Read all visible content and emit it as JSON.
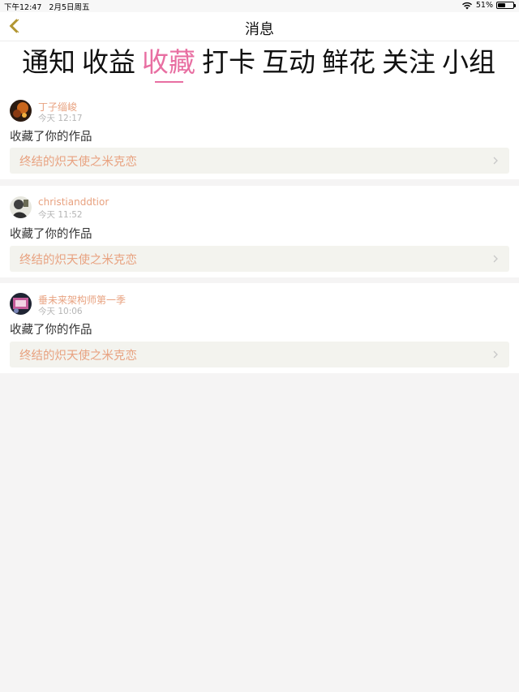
{
  "status": {
    "time": "下午12:47",
    "date": "2月5日周五",
    "battery": "51%",
    "battery_level": 0.51
  },
  "nav": {
    "title": "消息",
    "back_icon": "chevron-left-icon"
  },
  "tabs": [
    {
      "label": "通知"
    },
    {
      "label": "收益"
    },
    {
      "label": "收藏",
      "active": true
    },
    {
      "label": "打卡"
    },
    {
      "label": "互动"
    },
    {
      "label": "鲜花"
    },
    {
      "label": "关注"
    },
    {
      "label": "小组"
    }
  ],
  "notifications": [
    {
      "user": "丁子缁峻",
      "time": "今天 12:17",
      "action": "收藏了你的作品",
      "work": "终结的炽天使之米克恋"
    },
    {
      "user": "christianddtior",
      "time": "今天 11:52",
      "action": "收藏了你的作品",
      "work": "终结的炽天使之米克恋"
    },
    {
      "user": "垂未来架构师第一季",
      "time": "今天 10:06",
      "action": "收藏了你的作品",
      "work": "终结的炽天使之米克恋"
    }
  ],
  "colors": {
    "accent": "#e86fa2",
    "username": "#e8a280",
    "work_link_bg": "#f3f3ee"
  }
}
